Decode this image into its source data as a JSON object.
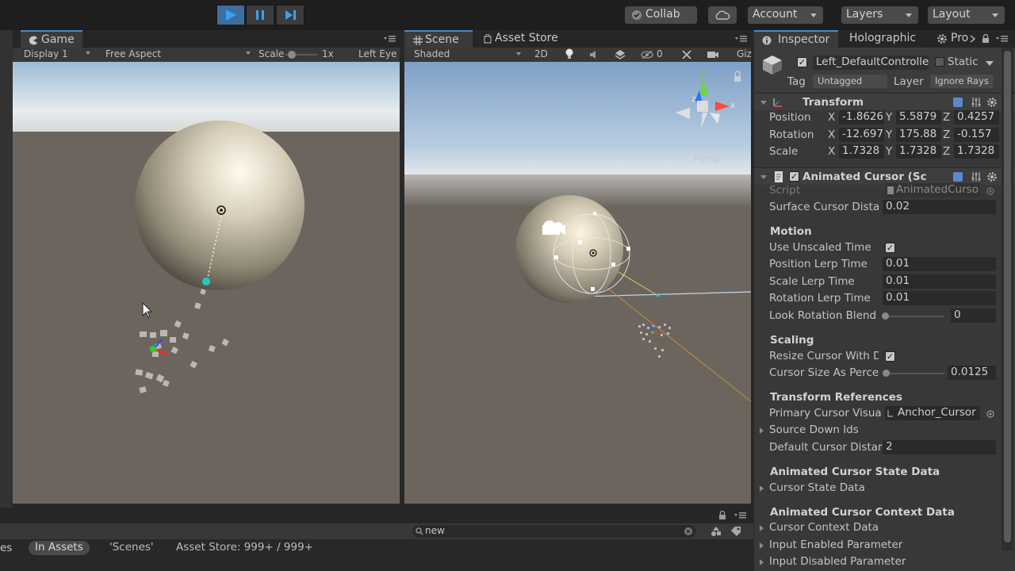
{
  "toolbar": {
    "collab_label": "Collab",
    "account_label": "Account",
    "layers_label": "Layers",
    "layout_label": "Layout"
  },
  "game": {
    "tab_label": "Game",
    "display": "Display 1",
    "aspect": "Free Aspect",
    "scale_label": "Scale",
    "scale_value": "1x",
    "eye": "Left Eye"
  },
  "scene": {
    "tab_label": "Scene",
    "asset_store_tab": "Asset Store",
    "shading": "Shaded",
    "mode_2d": "2D",
    "hidden_count": "0",
    "gizmos_label": "Giz",
    "persp_label": "Persp",
    "gizmo_y": "y",
    "gizmo_z": "z",
    "gizmo_x": "x"
  },
  "inspector": {
    "tab_label": "Inspector",
    "holographic_tab": "Holographic",
    "project_tab": "Pro",
    "object_name": "Left_DefaultControlle",
    "static_label": "Static",
    "tag_label": "Tag",
    "tag_value": "Untagged",
    "layer_label": "Layer",
    "layer_value": "Ignore Rays",
    "transform": {
      "title": "Transform",
      "position_label": "Position",
      "position": {
        "x": "-1.8626",
        "y": "5.5879",
        "z": "0.4257"
      },
      "rotation_label": "Rotation",
      "rotation": {
        "x": "-12.697",
        "y": "175.88",
        "z": "-0.157"
      },
      "scale_label": "Scale",
      "scale": {
        "x": "1.7328",
        "y": "1.7328",
        "z": "1.7328"
      },
      "axis_x": "X",
      "axis_y": "Y",
      "axis_z": "Z"
    },
    "animated_cursor": {
      "title": "Animated Cursor (Sc",
      "script_label": "Script",
      "script_value": "AnimatedCurso",
      "surface_distance_label": "Surface Cursor Dista",
      "surface_distance_value": "0.02",
      "motion_header": "Motion",
      "unscaled_time_label": "Use Unscaled Time",
      "position_lerp_label": "Position Lerp Time",
      "position_lerp_value": "0.01",
      "scale_lerp_label": "Scale Lerp Time",
      "scale_lerp_value": "0.01",
      "rotation_lerp_label": "Rotation Lerp Time",
      "rotation_lerp_value": "0.01",
      "look_rotation_label": "Look Rotation Blend",
      "look_rotation_value": "0",
      "scaling_header": "Scaling",
      "resize_label": "Resize Cursor With D",
      "size_percent_label": "Cursor Size As Perce",
      "size_percent_value": "0.0125",
      "transform_refs_header": "Transform References",
      "primary_visual_label": "Primary Cursor Visua",
      "primary_visual_value": "Anchor_Cursor",
      "source_down_label": "Source Down Ids",
      "default_distance_label": "Default Cursor Distar",
      "default_distance_value": "2",
      "state_data_header": "Animated Cursor State Data",
      "state_data_label": "Cursor State Data",
      "context_header": "Animated Cursor Context Data",
      "context_label": "Cursor Context Data",
      "input_enabled_label": "Input Enabled Parameter",
      "input_disabled_label": "Input Disabled Parameter"
    }
  },
  "bottom": {
    "search_value": "new",
    "crumb_left": "es",
    "in_assets": "In Assets",
    "scenes": "'Scenes'",
    "asset_store": "Asset Store: 999+ / 999+"
  },
  "colors": {
    "accent_blue": "#4a88c8",
    "play_active": "#3d6ea0",
    "editor_dark": "#282828",
    "panel": "#383838"
  }
}
